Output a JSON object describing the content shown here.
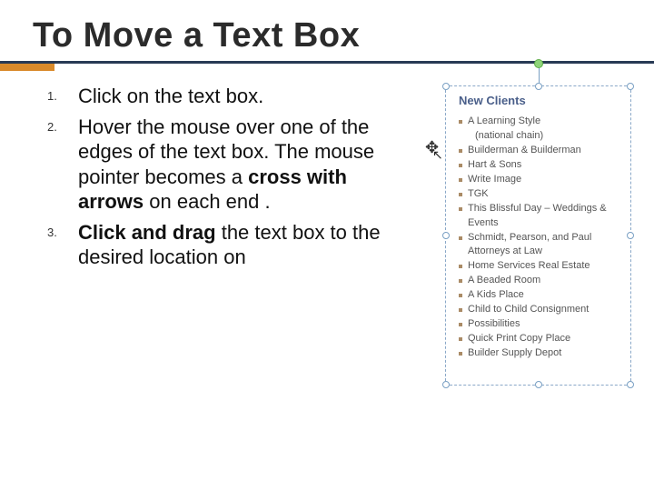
{
  "title": "To Move a Text Box",
  "steps": [
    {
      "num": "1.",
      "prefix": "",
      "bold": "",
      "suffix": "Click on the text box."
    },
    {
      "num": "2.",
      "prefix": "Hover the mouse over one of the edges of the text box. The mouse pointer becomes a ",
      "bold": "cross with arrows",
      "suffix": " on each end ."
    },
    {
      "num": "3.",
      "prefix": "",
      "bold": "Click and drag",
      "suffix": " the text box to the desired location on"
    }
  ],
  "textbox": {
    "heading": "New Clients",
    "items": [
      "A Learning Style",
      "Builderman & Builderman",
      "Hart & Sons",
      "Write Image",
      "TGK",
      "This Blissful Day – Weddings & Events",
      "Schmidt, Pearson, and Paul Attorneys at Law",
      "Home Services Real Estate",
      "A Beaded Room",
      "A Kids Place",
      "Child to Child Consignment",
      "Possibilities",
      "Quick Print Copy Place",
      "Builder Supply Depot"
    ],
    "sublabel_0": "(national chain)"
  },
  "icons": {
    "move_cursor": "✥",
    "arrow_cursor": "↖"
  },
  "colors": {
    "rule_top": "#283a55",
    "rule_accent": "#d98a2b",
    "textbox_border": "#8aa8c8",
    "textbox_title": "#4a5f8a"
  }
}
